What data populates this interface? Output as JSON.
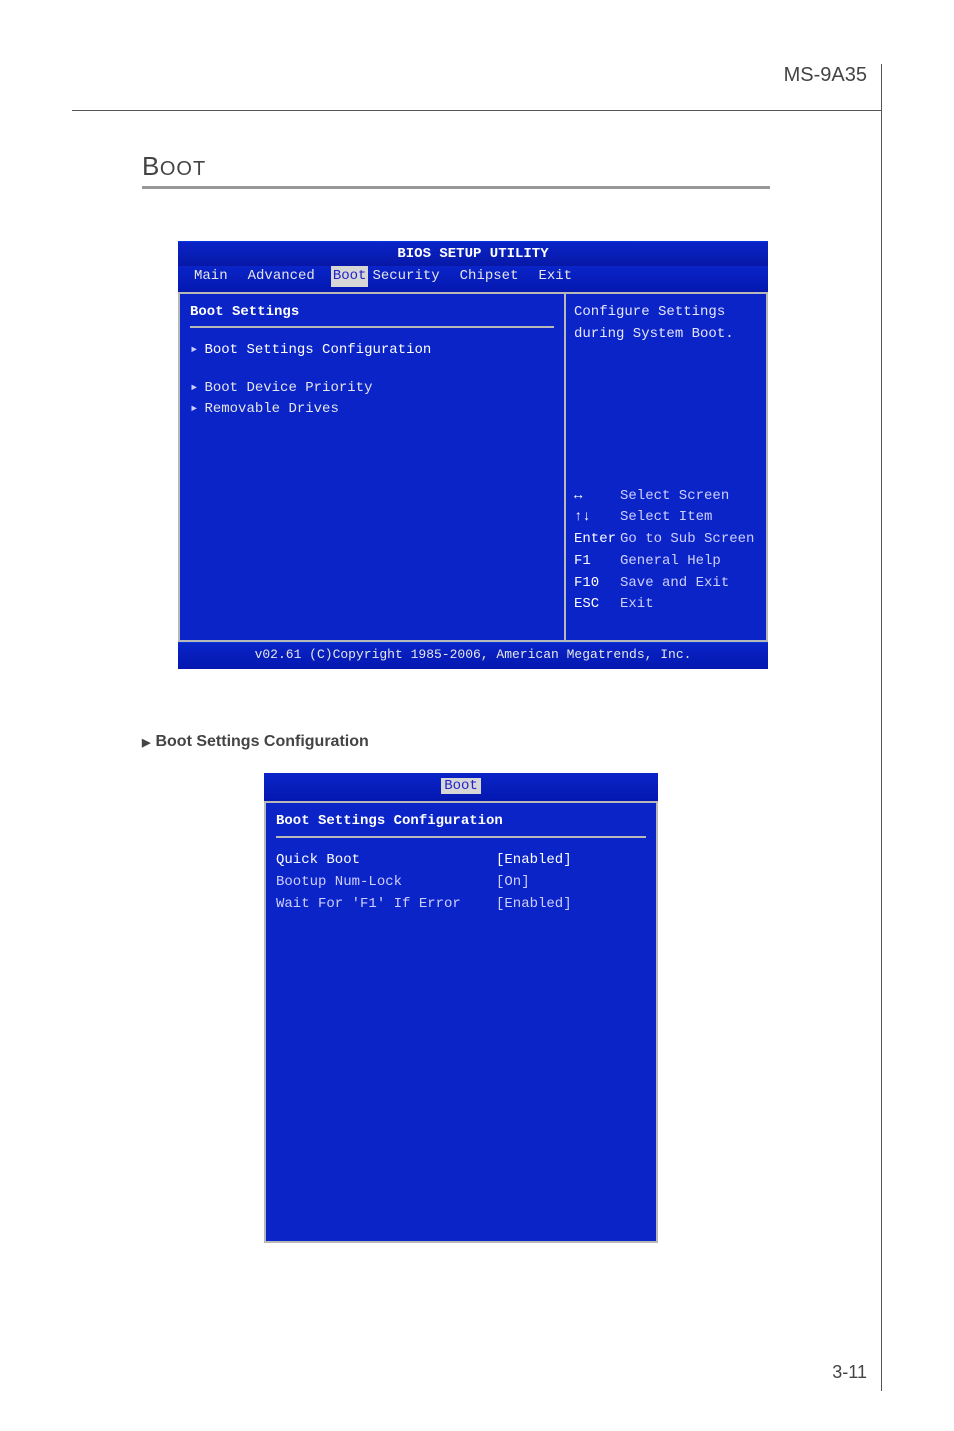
{
  "header": {
    "model": "MS-9A35"
  },
  "section": {
    "title_first_letter": "B",
    "title_rest": "OOT"
  },
  "bios1": {
    "title": "BIOS SETUP UTILITY",
    "tabs": {
      "main": "Main",
      "advanced": "Advanced",
      "boot": "Boot",
      "security": "Security",
      "chipset": "Chipset",
      "exit": "Exit"
    },
    "panel_heading": "Boot Settings",
    "items": {
      "cfg": "Boot Settings Configuration",
      "priority": "Boot Device Priority",
      "removable": "Removable Drives"
    },
    "help_desc": "Configure Settings during System Boot.",
    "keys": {
      "lr": {
        "k": "↔",
        "d": "Select Screen"
      },
      "ud": {
        "k": "↑↓",
        "d": "Select Item"
      },
      "enter": {
        "k": "Enter",
        "d": "Go to Sub Screen"
      },
      "f1": {
        "k": "F1",
        "d": "General Help"
      },
      "f10": {
        "k": "F10",
        "d": "Save and Exit"
      },
      "esc": {
        "k": "ESC",
        "d": "Exit"
      }
    },
    "footer": "v02.61 (C)Copyright 1985-2006, American Megatrends, Inc."
  },
  "sub1": {
    "label": "Boot Settings Configuration",
    "tab": "Boot",
    "heading": "Boot Settings Configuration",
    "rows": {
      "quickboot": {
        "name": "Quick Boot",
        "val": "[Enabled]"
      },
      "numlock": {
        "name": "Bootup Num-Lock",
        "val": "[On]"
      },
      "f1err": {
        "name": "Wait For 'F1' If Error",
        "val": "[Enabled]"
      }
    }
  },
  "pagenum": "3-11"
}
